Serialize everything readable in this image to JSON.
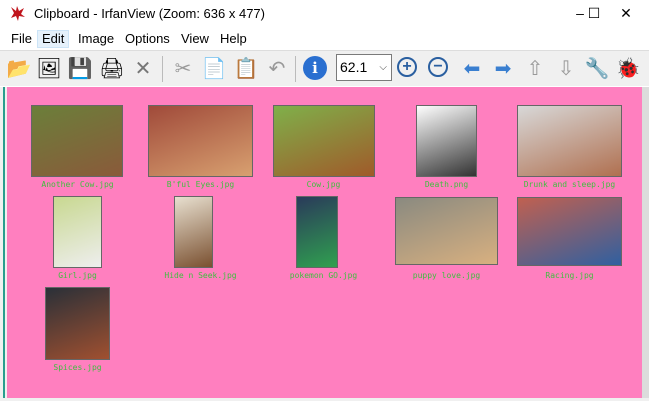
{
  "window": {
    "title": "Clipboard - IrfanView (Zoom: 636 x 477)",
    "minimize": "–",
    "maximize": "☐",
    "close": "✕"
  },
  "menu": [
    "File",
    "Edit",
    "Image",
    "Options",
    "View",
    "Help"
  ],
  "toolbar": {
    "zoom_value": "62.1",
    "zoom_chevron": "⌵",
    "icons": {
      "open": "📂",
      "slideshow": "🖼",
      "save": "💾",
      "print": "🖨",
      "delete": "✕",
      "cut": "✂",
      "copy": "📄",
      "paste": "📋",
      "undo": "↶",
      "info": "i",
      "zoom_in": "+",
      "zoom_out": "−",
      "prev": "⬅",
      "next": "➡",
      "move_up": "⇧",
      "move_down": "⇩",
      "settings": "🔧",
      "irfan": "🐞"
    }
  },
  "thumbnails": [
    {
      "name": "Another Cow.jpg",
      "color1": "#6b7f3a",
      "color2": "#8a5a3a"
    },
    {
      "name": "B'ful Eyes.jpg",
      "color1": "#a04a3a",
      "color2": "#d8a070"
    },
    {
      "name": "Cow.jpg",
      "color1": "#7fb04a",
      "color2": "#a05a2a"
    },
    {
      "name": "Death.png",
      "color1": "#ffffff",
      "color2": "#333333"
    },
    {
      "name": "Drunk and sleep.jpg",
      "color1": "#d8d8d8",
      "color2": "#b07050"
    },
    {
      "name": "Girl.jpg",
      "color1": "#c8d890",
      "color2": "#eeeeee"
    },
    {
      "name": "Hide n Seek.jpg",
      "color1": "#e8e0d0",
      "color2": "#7a5030"
    },
    {
      "name": "pokemon GO.jpg",
      "color1": "#2a3a5a",
      "color2": "#30a050"
    },
    {
      "name": "puppy love.jpg",
      "color1": "#8a8a80",
      "color2": "#d8b080"
    },
    {
      "name": "Racing.jpg",
      "color1": "#c06050",
      "color2": "#3060a0"
    },
    {
      "name": "Spices.jpg",
      "color1": "#2a3038",
      "color2": "#a05030"
    }
  ]
}
